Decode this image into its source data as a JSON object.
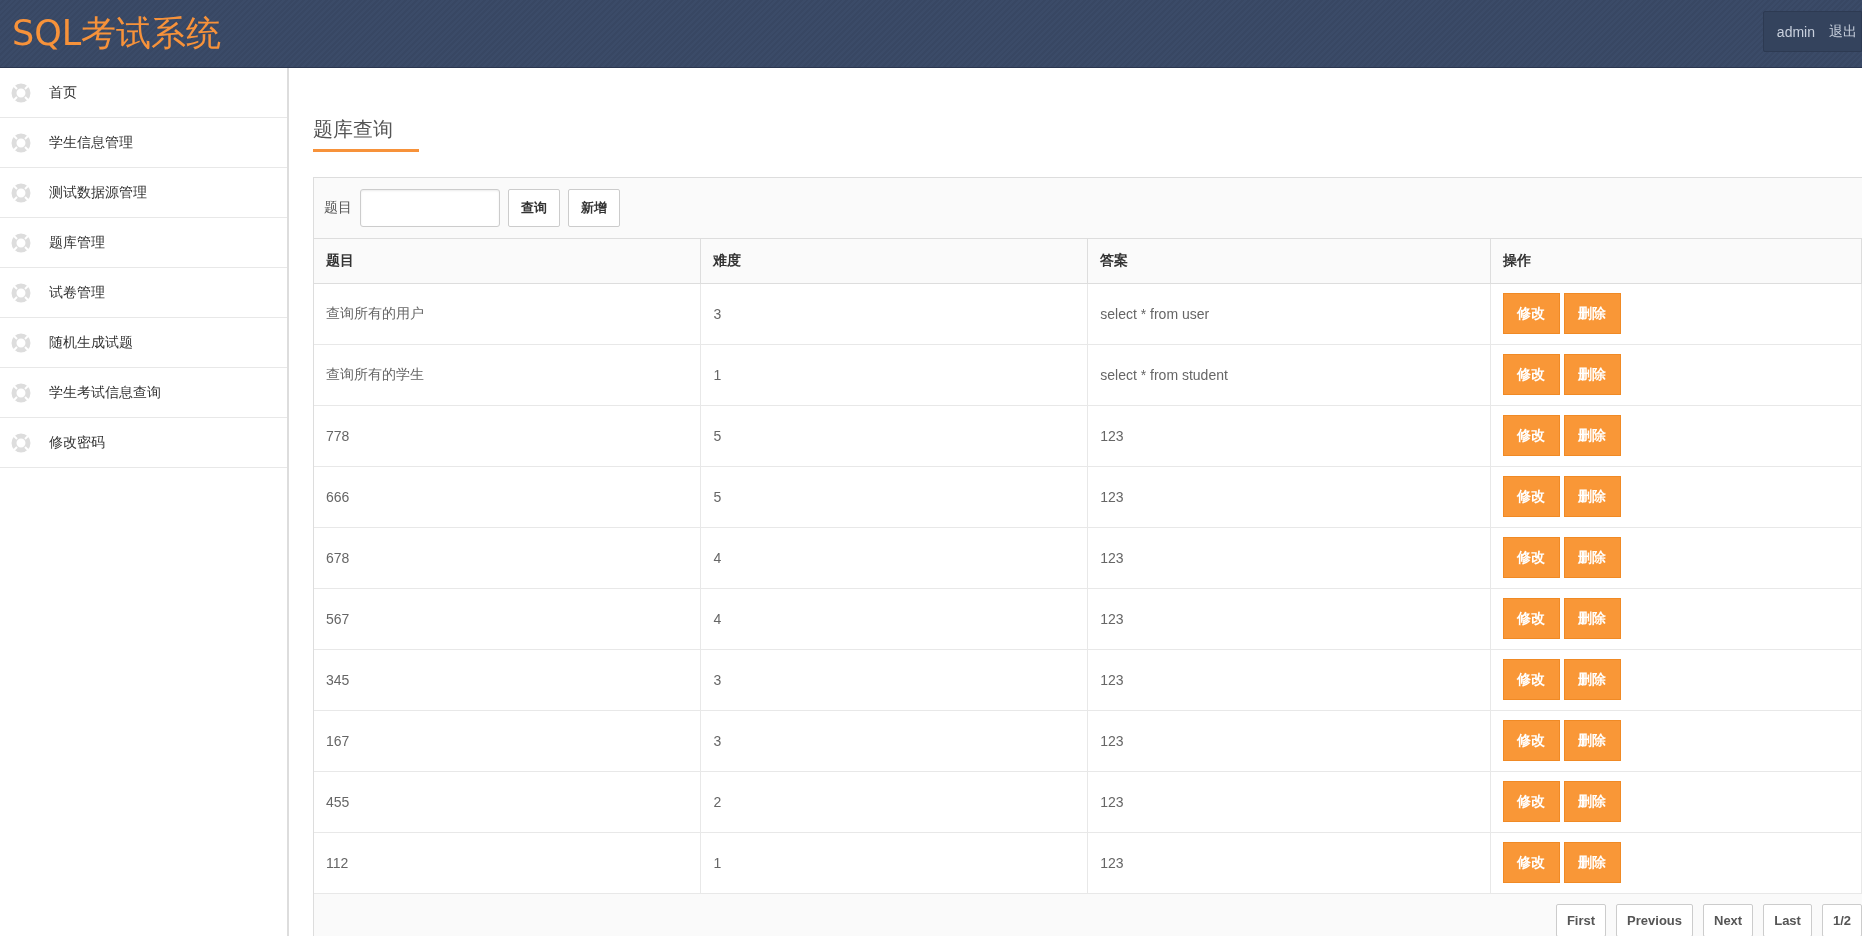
{
  "header": {
    "title": "SQL考试系统",
    "user": "admin",
    "logout": "退出"
  },
  "sidebar": {
    "items": [
      {
        "label": "首页",
        "selected": false
      },
      {
        "label": "学生信息管理",
        "selected": false
      },
      {
        "label": "测试数据源管理",
        "selected": false
      },
      {
        "label": "题库管理",
        "selected": false
      },
      {
        "label": "试卷管理",
        "selected": false
      },
      {
        "label": "随机生成试题",
        "selected": false
      },
      {
        "label": "学生考试信息查询",
        "selected": false
      },
      {
        "label": "修改密码",
        "selected": false
      }
    ]
  },
  "page_title": "题库查询",
  "search": {
    "label": "题目",
    "query_button": "查询",
    "add_button": "新增"
  },
  "table": {
    "columns": [
      "题目",
      "难度",
      "答案",
      "操作"
    ],
    "rows": [
      {
        "question": "查询所有的用户",
        "difficulty": "3",
        "answer": "select * from user",
        "actions": [
          "修改",
          "删除"
        ]
      },
      {
        "question": "查询所有的学生",
        "difficulty": "1",
        "answer": "select * from student",
        "actions": [
          "修改",
          "删除"
        ]
      },
      {
        "question": "778",
        "difficulty": "5",
        "answer": "123",
        "actions": [
          "修改",
          "删除"
        ]
      },
      {
        "question": "666",
        "difficulty": "5",
        "answer": "123",
        "actions": [
          "修改",
          "删除"
        ]
      },
      {
        "question": "678",
        "difficulty": "4",
        "answer": "123",
        "actions": [
          "修改",
          "删除"
        ]
      },
      {
        "question": "567",
        "difficulty": "4",
        "answer": "123",
        "actions": [
          "修改",
          "删除"
        ]
      },
      {
        "question": "345",
        "difficulty": "3",
        "answer": "123",
        "actions": [
          "修改",
          "删除"
        ]
      },
      {
        "question": "167",
        "difficulty": "3",
        "answer": "123",
        "actions": [
          "修改",
          "删除"
        ]
      },
      {
        "question": "455",
        "difficulty": "2",
        "answer": "123",
        "actions": [
          "修改",
          "删除"
        ]
      },
      {
        "question": "112",
        "difficulty": "1",
        "answer": "123",
        "actions": [
          "修改",
          "删除"
        ]
      }
    ]
  },
  "pagination": [
    "First",
    "Previous",
    "Next",
    "Last",
    "1/2"
  ]
}
